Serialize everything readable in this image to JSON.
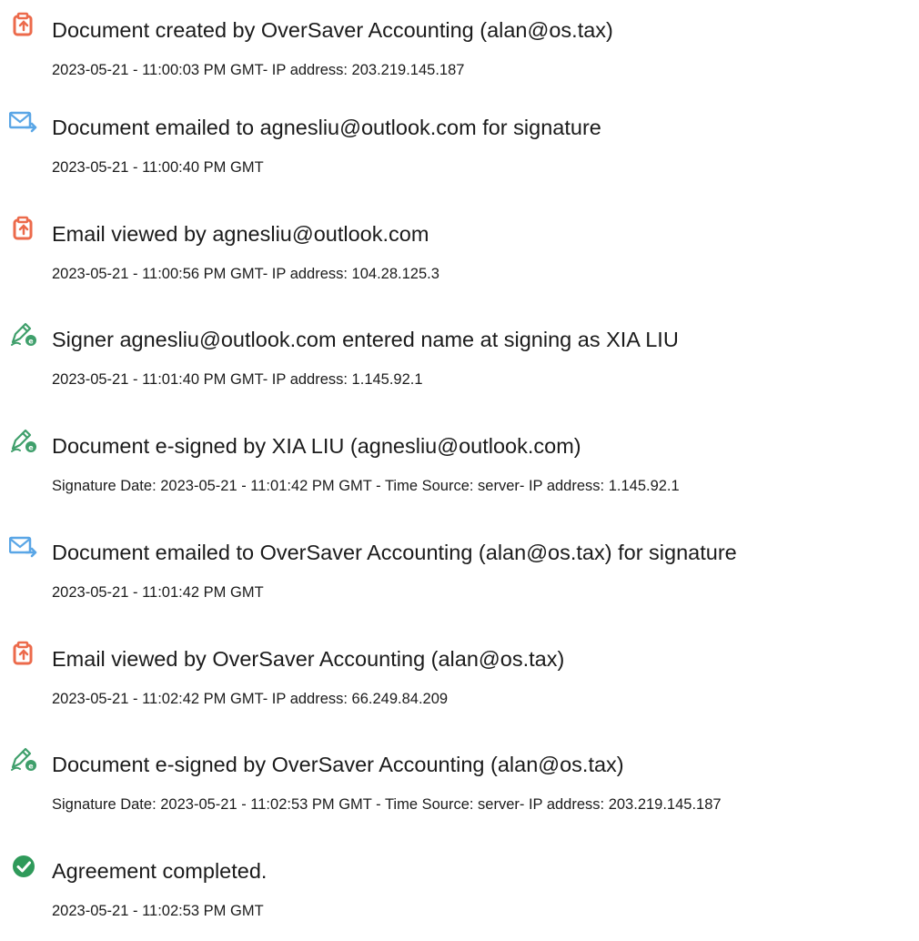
{
  "colors": {
    "document_icon": "#ec6a4b",
    "email_icon": "#5aa6e6",
    "signature_icon": "#3f9f6b",
    "complete_icon": "#2f9a5a",
    "text": "#1b1b1b"
  },
  "events": [
    {
      "icon": "document-icon",
      "title": "Document created by OverSaver Accounting (alan@os.tax)",
      "detail": "2023-05-21 - 11:00:03 PM GMT- IP address: 203.219.145.187"
    },
    {
      "icon": "email-icon",
      "title": "Document emailed to agnesliu@outlook.com for signature",
      "detail": "2023-05-21 - 11:00:40 PM GMT"
    },
    {
      "icon": "document-icon",
      "title": "Email viewed by agnesliu@outlook.com",
      "detail": "2023-05-21 - 11:00:56 PM GMT- IP address: 104.28.125.3"
    },
    {
      "icon": "signature-icon",
      "title": "Signer agnesliu@outlook.com entered name at signing as XIA LIU",
      "detail": "2023-05-21 - 11:01:40 PM GMT- IP address: 1.145.92.1"
    },
    {
      "icon": "signature-icon",
      "title": "Document e-signed by XIA LIU (agnesliu@outlook.com)",
      "detail": "Signature Date: 2023-05-21 - 11:01:42 PM GMT - Time Source: server- IP address: 1.145.92.1"
    },
    {
      "icon": "email-icon",
      "title": "Document emailed to OverSaver Accounting (alan@os.tax) for signature",
      "detail": "2023-05-21 - 11:01:42 PM GMT"
    },
    {
      "icon": "document-icon",
      "title": "Email viewed by OverSaver Accounting (alan@os.tax)",
      "detail": "2023-05-21 - 11:02:42 PM GMT- IP address: 66.249.84.209"
    },
    {
      "icon": "signature-icon",
      "title": "Document e-signed by OverSaver Accounting (alan@os.tax)",
      "detail": "Signature Date: 2023-05-21 - 11:02:53 PM GMT - Time Source: server- IP address: 203.219.145.187"
    },
    {
      "icon": "checkmark-icon",
      "title": "Agreement completed.",
      "detail": "2023-05-21 - 11:02:53 PM GMT"
    }
  ]
}
